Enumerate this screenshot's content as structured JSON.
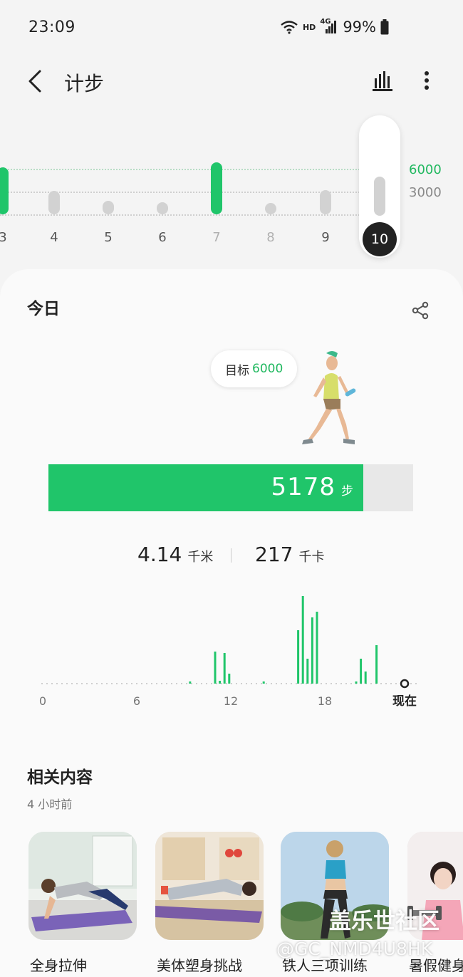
{
  "status_bar": {
    "time": "23:09",
    "network_label": "HD",
    "signal_type": "4G",
    "battery": "99%",
    "icons": [
      "wifi-icon",
      "signal-icon",
      "battery-icon"
    ]
  },
  "header": {
    "title": "计步",
    "icons": [
      "back-arrow-icon",
      "bar-chart-icon",
      "more-vert-icon"
    ]
  },
  "week_chart": {
    "days": [
      {
        "label": "3",
        "steps": 6200,
        "goal_met": true
      },
      {
        "label": "4",
        "steps": 3100,
        "goal_met": false
      },
      {
        "label": "5",
        "steps": 1800,
        "goal_met": false
      },
      {
        "label": "6",
        "steps": 1600,
        "goal_met": false
      },
      {
        "label": "7",
        "steps": 6800,
        "goal_met": true
      },
      {
        "label": "8",
        "steps": 300,
        "goal_met": false
      },
      {
        "label": "9",
        "steps": 3200,
        "goal_met": false
      },
      {
        "label": "10",
        "steps": 5178,
        "goal_met": false,
        "selected": true
      }
    ],
    "goal_label": "6000",
    "mid_label": "3000"
  },
  "today": {
    "title": "今日",
    "goal_text": "目标",
    "goal_value": "6000",
    "steps": "5178",
    "steps_unit": "步",
    "steps_value": 5178,
    "goal_steps": 6000,
    "distance": "4.14",
    "distance_unit": "千米",
    "calories": "217",
    "calories_unit": "千卡"
  },
  "chart_data": {
    "type": "bar",
    "title": "",
    "xlabel": "",
    "ylabel": "",
    "x_ticks": [
      "0",
      "6",
      "12",
      "18",
      "现在"
    ],
    "x_range": [
      0,
      23
    ],
    "values": [
      {
        "hour": 9.4,
        "v": 3
      },
      {
        "hour": 11.0,
        "v": 45
      },
      {
        "hour": 11.3,
        "v": 4
      },
      {
        "hour": 11.6,
        "v": 43
      },
      {
        "hour": 11.9,
        "v": 14
      },
      {
        "hour": 14.1,
        "v": 3
      },
      {
        "hour": 16.3,
        "v": 75
      },
      {
        "hour": 16.6,
        "v": 123
      },
      {
        "hour": 16.9,
        "v": 35
      },
      {
        "hour": 17.2,
        "v": 93
      },
      {
        "hour": 17.5,
        "v": 101
      },
      {
        "hour": 20.0,
        "v": 3
      },
      {
        "hour": 20.3,
        "v": 35
      },
      {
        "hour": 20.6,
        "v": 17
      },
      {
        "hour": 21.3,
        "v": 54
      }
    ]
  },
  "related": {
    "title": "相关内容",
    "time": "4 小时前",
    "items": [
      {
        "label": "全身拉伸"
      },
      {
        "label": "美体塑身挑战"
      },
      {
        "label": "铁人三项训练"
      },
      {
        "label": "暑假健身"
      }
    ]
  },
  "watermark": {
    "line1": "盖乐世社区",
    "line2": "@GC_NMD4U8HK"
  }
}
